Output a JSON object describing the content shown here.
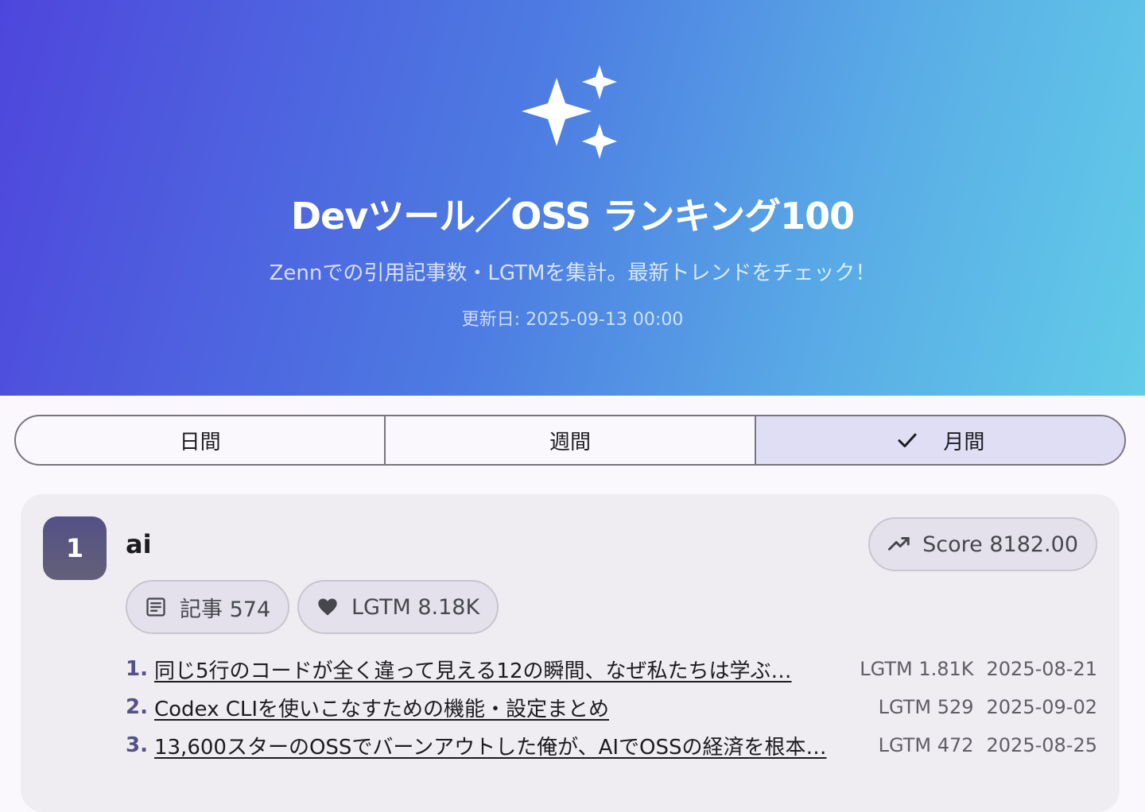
{
  "hero": {
    "icon": "sparkles-icon",
    "title": "Devツール／OSS ランキング100",
    "subtitle": "Zennでの引用記事数・LGTMを集計。最新トレンドをチェック！",
    "updated": "更新日: 2025-09-13 00:00",
    "gradient_start": "#4e46dc",
    "gradient_end": "#62cce8"
  },
  "tabs": {
    "items": [
      {
        "label": "日間",
        "selected": false
      },
      {
        "label": "週間",
        "selected": false
      },
      {
        "label": "月間",
        "selected": true
      }
    ],
    "selected_icon": "check-icon"
  },
  "ranking": [
    {
      "rank": "1",
      "tag": "ai",
      "score_icon": "trending-up-icon",
      "score": "Score 8182.00",
      "articles_icon": "article-icon",
      "articles": "記事 574",
      "lgtm_icon": "heart-icon",
      "lgtm": "LGTM 8.18K",
      "items": [
        {
          "num": "1.",
          "title": "同じ5行のコードが全く違って見える12の瞬間、なぜ私たちは学ぶ…",
          "lgtm": "LGTM 1.81K",
          "date": "2025-08-21"
        },
        {
          "num": "2.",
          "title": "Codex CLIを使いこなすための機能・設定まとめ",
          "lgtm": "LGTM 529",
          "date": "2025-09-02"
        },
        {
          "num": "3.",
          "title": "13,600スターのOSSでバーンアウトした俺が、AIでOSSの経済を根本…",
          "lgtm": "LGTM 472",
          "date": "2025-08-25"
        }
      ]
    }
  ],
  "colors": {
    "accent": "#545088",
    "tab_selected_bg": "#e0def4",
    "card_bg": "#efedf1"
  }
}
